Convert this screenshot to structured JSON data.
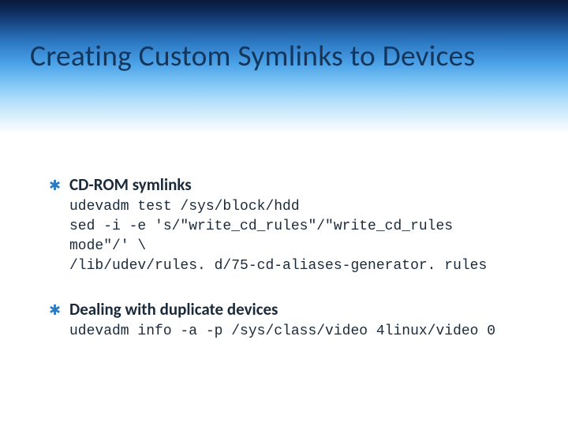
{
  "title": "Creating Custom Symlinks to Devices",
  "bullets": [
    {
      "star": "✱",
      "heading": "CD-ROM symlinks",
      "code": "udevadm test /sys/block/hdd\nsed -i -e 's/\"write_cd_rules\"/\"write_cd_rules mode\"/' \\\n/lib/udev/rules. d/75-cd-aliases-generator. rules"
    },
    {
      "star": "✱",
      "heading": "Dealing with duplicate devices",
      "code": "udevadm info -a -p /sys/class/video 4linux/video 0"
    }
  ]
}
